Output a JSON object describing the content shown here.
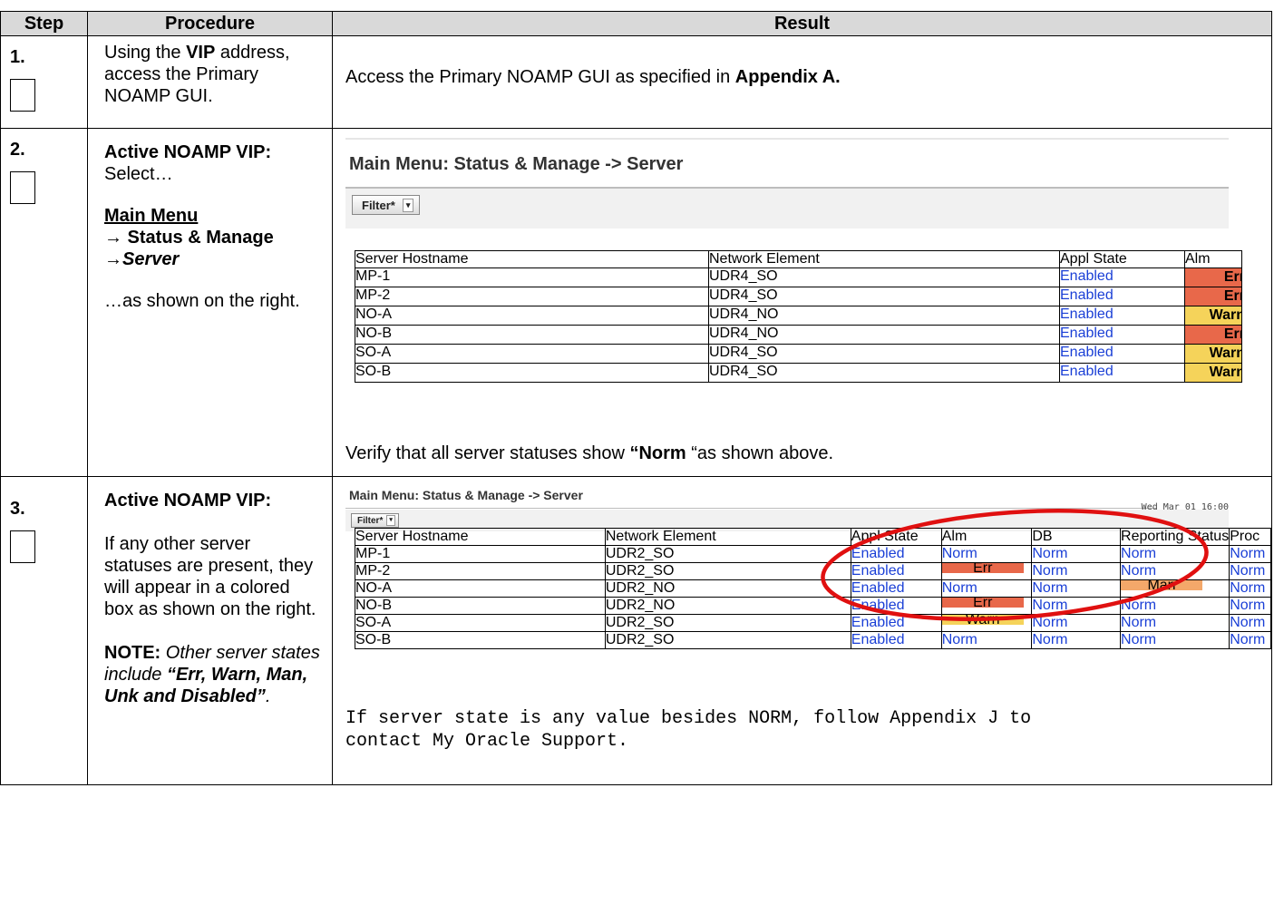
{
  "header": {
    "step": "Step",
    "procedure": "Procedure",
    "result": "Result"
  },
  "steps": [
    {
      "number": "1.",
      "procedure": {
        "t1": "Using the ",
        "vip": "VIP",
        "t2": " address, access the Primary NOAMP GUI."
      },
      "result": {
        "t1": "Access the Primary NOAMP GUI as specified in ",
        "bold": "Appendix A."
      }
    },
    {
      "number": "2.",
      "procedure": {
        "heading": "Active NOAMP VIP:",
        "select": "Select…",
        "menu_main": "Main Menu",
        "menu_status": "→ Status & Manage",
        "menu_arrow": "→",
        "menu_server": "Server",
        "tail": "…as shown on the right."
      },
      "result": {
        "t1": "Verify that all server statuses show ",
        "bold": "“Norm",
        "t2": " “as shown above."
      }
    },
    {
      "number": "3.",
      "procedure": {
        "heading": "Active NOAMP VIP:",
        "body": "If any other server statuses are present, they will appear in a colored box as shown on the right.",
        "note_label": "NOTE:",
        "note_text": " Other server states include ",
        "note_bold": "“Err, Warn, Man, Unk and Disabled”",
        "note_end": "."
      },
      "result": {
        "text": "If server state is any value besides NORM, follow Appendix J to\ncontact My Oracle Support."
      }
    }
  ],
  "screenshot1": {
    "title": "Main Menu: Status & Manage -> Server",
    "filter_label": "Filter*",
    "filter_caret": "▾",
    "columns": [
      "Server Hostname",
      "Network Element",
      "Appl State",
      "Alm"
    ],
    "rows": [
      [
        "MP-1",
        "UDR4_SO",
        "Enabled",
        "Err"
      ],
      [
        "MP-2",
        "UDR4_SO",
        "Enabled",
        "Err"
      ],
      [
        "NO-A",
        "UDR4_NO",
        "Enabled",
        "Warn"
      ],
      [
        "NO-B",
        "UDR4_NO",
        "Enabled",
        "Err"
      ],
      [
        "SO-A",
        "UDR4_SO",
        "Enabled",
        "Warn"
      ],
      [
        "SO-B",
        "UDR4_SO",
        "Enabled",
        "Warn"
      ]
    ]
  },
  "screenshot2": {
    "title": "Main Menu: Status & Manage -> Server",
    "timestamp": "Wed Mar 01 16:00",
    "filter_label": "Filter*",
    "filter_caret": "▾",
    "columns": [
      "Server Hostname",
      "Network Element",
      "Appl State",
      "Alm",
      "DB",
      "Reporting Status",
      "Proc"
    ],
    "rows": [
      [
        "MP-1",
        "UDR2_SO",
        "Enabled",
        "Norm",
        "Norm",
        "Norm",
        "Norm"
      ],
      [
        "MP-2",
        "UDR2_SO",
        "Enabled",
        "Err",
        "Norm",
        "Norm",
        "Norm"
      ],
      [
        "NO-A",
        "UDR2_NO",
        "Enabled",
        "Norm",
        "Norm",
        "Man",
        "Norm"
      ],
      [
        "NO-B",
        "UDR2_NO",
        "Enabled",
        "Err",
        "Norm",
        "Norm",
        "Norm"
      ],
      [
        "SO-A",
        "UDR2_SO",
        "Enabled",
        "Warn",
        "Norm",
        "Norm",
        "Norm"
      ],
      [
        "SO-B",
        "UDR2_SO",
        "Enabled",
        "Norm",
        "Norm",
        "Norm",
        "Norm"
      ]
    ]
  },
  "colors": {
    "err": "#e8684a",
    "warn": "#f5d35a",
    "man": "#f4a86a",
    "link": "#1a3fd6",
    "highlight_ellipse": "#e01010"
  }
}
